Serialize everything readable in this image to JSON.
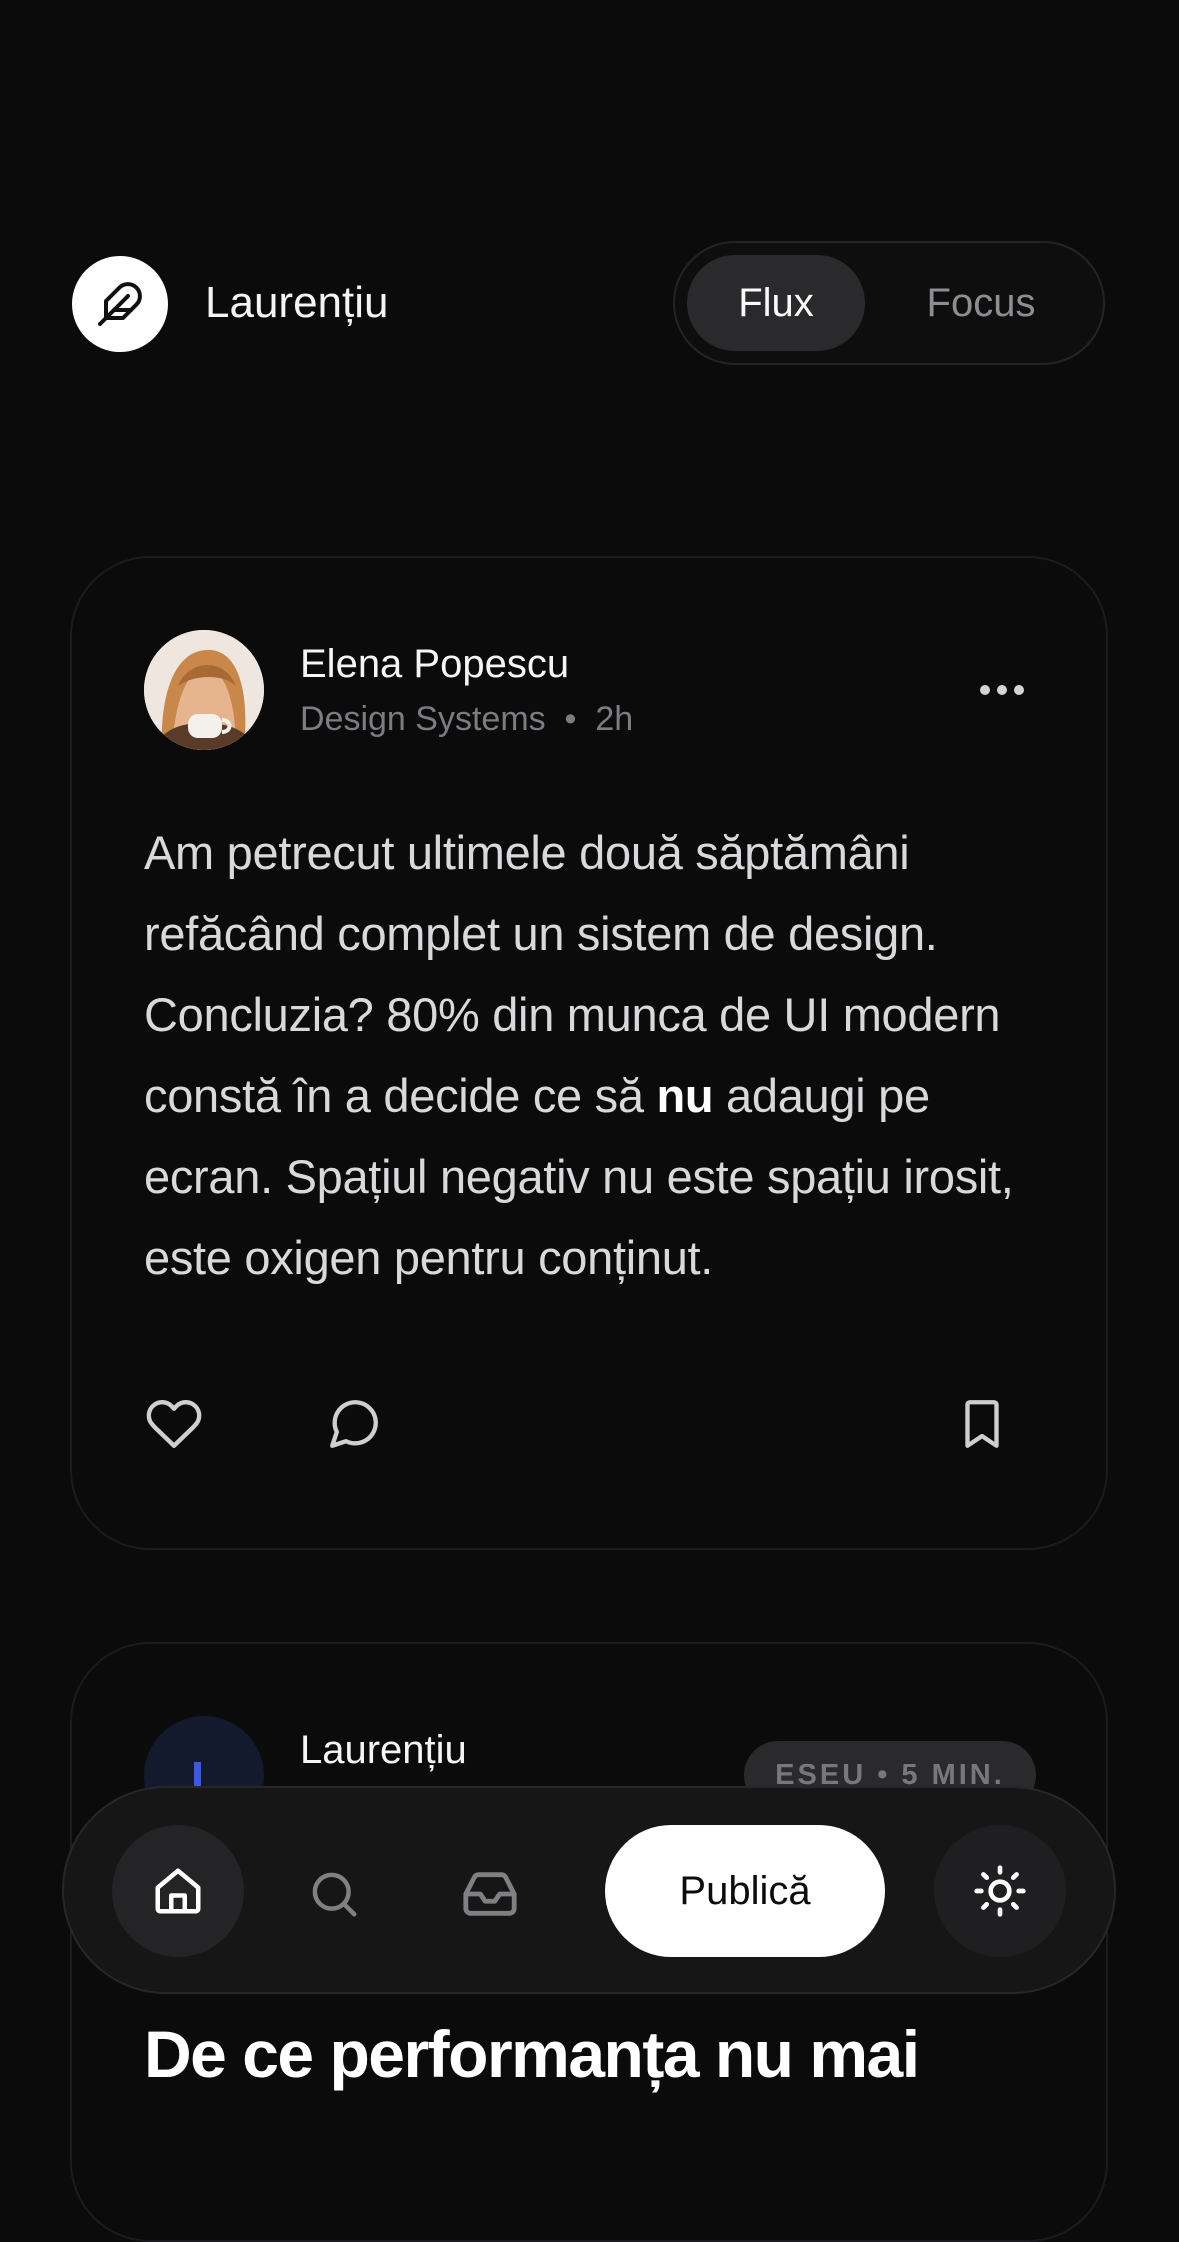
{
  "header": {
    "logo_icon": "feather-icon",
    "user_name": "Laurențiu",
    "view_toggle": {
      "active": "Flux",
      "inactive": "Focus"
    }
  },
  "post": {
    "author": "Elena Popescu",
    "topic": "Design Systems",
    "time": "2h",
    "body_before": "Am petrecut ultimele două săptămâni refăcând complet un sistem de design. Concluzia? 80% din munca de UI modern constă în a decide ce să ",
    "body_emphasis": "nu",
    "body_after": " adaugi pe ecran. Spațiul negativ nu este spațiu irosit, este oxigen pentru conținut.",
    "actions": [
      "heart-icon",
      "comment-icon",
      "bookmark-icon"
    ]
  },
  "post2": {
    "author": "Laurențiu",
    "tag": "ESEU • 5 MIN.",
    "headline": "De ce performanța nu mai"
  },
  "nav": {
    "items": [
      "home-icon",
      "search-icon",
      "inbox-icon",
      "sun-icon"
    ],
    "publish_label": "Publică"
  },
  "colors": {
    "background": "#0b0b0c",
    "accent": "#3b5bdb",
    "primary_button": "#ffffff"
  }
}
